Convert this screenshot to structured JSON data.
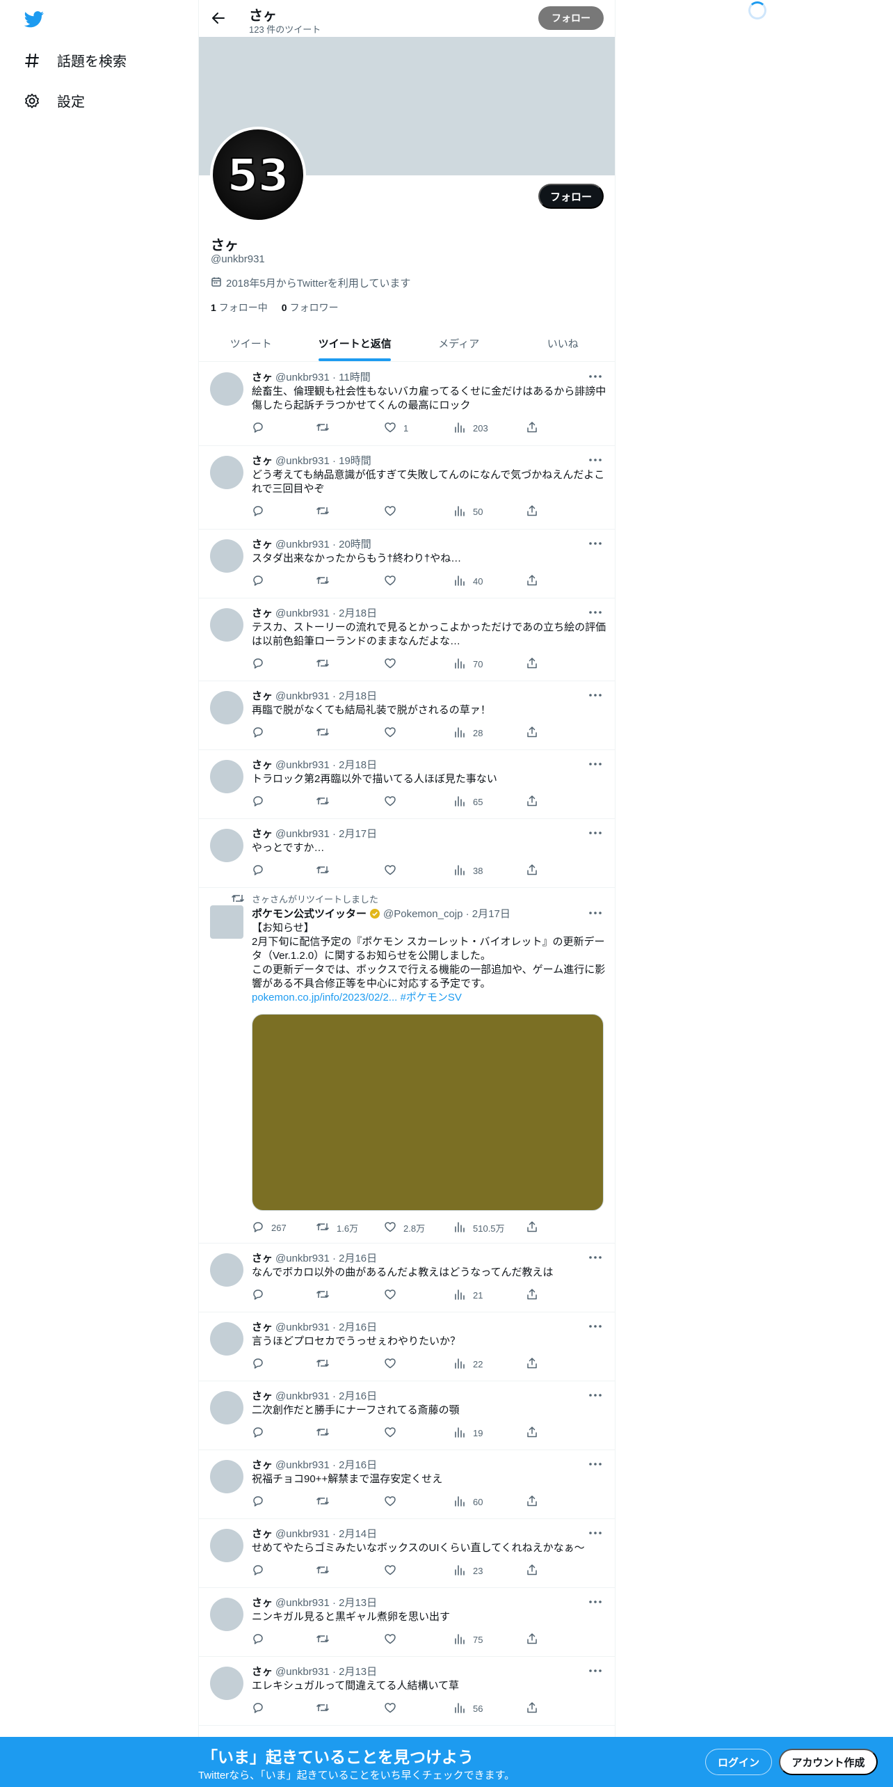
{
  "left_nav": {
    "items": [
      {
        "label": "話題を検索",
        "icon": "hashtag-icon"
      },
      {
        "label": "設定",
        "icon": "gear-icon"
      }
    ]
  },
  "header": {
    "name": "さヶ",
    "tweet_count": "123 件のツイート",
    "follow_label": "フォロー"
  },
  "profile": {
    "name": "さヶ",
    "handle": "@unkbr931",
    "joined": "2018年5月からTwitterを利用しています",
    "following_count": "1",
    "following_label": "フォロー中",
    "followers_count": "0",
    "followers_label": "フォロワー",
    "follow_label": "フォロー",
    "avatar_text": "53"
  },
  "tabs": [
    {
      "label": "ツイート"
    },
    {
      "label": "ツイートと返信"
    },
    {
      "label": "メディア"
    },
    {
      "label": "いいね"
    }
  ],
  "tweets": [
    {
      "name": "さヶ",
      "meta": "@unkbr931 · 11時間",
      "text": "絵畜生、倫理観も社会性もないバカ雇ってるくせに金だけはあるから誹謗中傷したら起訴チラつかせてくんの最高にロック",
      "reply": "",
      "retweet": "",
      "like": "1",
      "views": "203"
    },
    {
      "name": "さヶ",
      "meta": "@unkbr931 · 19時間",
      "text": "どう考えても納品意識が低すぎて失敗してんのになんで気づかねえんだよこれで三回目やぞ",
      "reply": "",
      "retweet": "",
      "like": "",
      "views": "50"
    },
    {
      "name": "さヶ",
      "meta": "@unkbr931 · 20時間",
      "text": "スタダ出来なかったからもう†終わり†やね…",
      "reply": "",
      "retweet": "",
      "like": "",
      "views": "40"
    },
    {
      "name": "さヶ",
      "meta": "@unkbr931 · 2月18日",
      "text": "テスカ、ストーリーの流れで見るとかっこよかっただけであの立ち絵の評価は以前色鉛筆ローランドのままなんだよな…",
      "reply": "",
      "retweet": "",
      "like": "",
      "views": "70"
    },
    {
      "name": "さヶ",
      "meta": "@unkbr931 · 2月18日",
      "text": "再臨で脱がなくても結局礼装で脱がされるの草ァ！",
      "reply": "",
      "retweet": "",
      "like": "",
      "views": "28"
    },
    {
      "name": "さヶ",
      "meta": "@unkbr931 · 2月18日",
      "text": "トラロック第2再臨以外で描いてる人ほぼ見た事ない",
      "reply": "",
      "retweet": "",
      "like": "",
      "views": "65"
    },
    {
      "name": "さヶ",
      "meta": "@unkbr931 · 2月17日",
      "text": "やっとですか…",
      "reply": "",
      "retweet": "",
      "like": "",
      "views": "38"
    }
  ],
  "retweet": {
    "note": "さヶさんがリツイートしました",
    "name": "ポケモン公式ツイッター",
    "meta": "@Pokemon_cojp · 2月17日",
    "text_lines": [
      "【お知らせ】",
      "2月下旬に配信予定の『ポケモン スカーレット・バイオレット』の更新データ（Ver.1.2.0）に関するお知らせを公開しました。",
      "この更新データでは、ボックスで行える機能の一部追加や、ゲーム進行に影響がある不具合修正等を中心に対応する予定です。"
    ],
    "link": "pokemon.co.jp/info/2023/02/2...",
    "hashtag": "#ポケモンSV",
    "media_color": "#7b6f24",
    "reply": "267",
    "retweet": "1.6万",
    "like": "2.8万",
    "views": "510.5万"
  },
  "tweets2": [
    {
      "name": "さヶ",
      "meta": "@unkbr931 · 2月16日",
      "text": "なんでボカロ以外の曲があるんだよ教えはどうなってんだ教えは",
      "reply": "",
      "retweet": "",
      "like": "",
      "views": "21"
    },
    {
      "name": "さヶ",
      "meta": "@unkbr931 · 2月16日",
      "text": "言うほどプロセカでうっせぇわやりたいか？",
      "reply": "",
      "retweet": "",
      "like": "",
      "views": "22"
    },
    {
      "name": "さヶ",
      "meta": "@unkbr931 · 2月16日",
      "text": "二次創作だと勝手にナーフされてる斎藤の顎",
      "reply": "",
      "retweet": "",
      "like": "",
      "views": "19"
    },
    {
      "name": "さヶ",
      "meta": "@unkbr931 · 2月16日",
      "text": "祝福チョコ90++解禁まで温存安定くせえ",
      "reply": "",
      "retweet": "",
      "like": "",
      "views": "60"
    },
    {
      "name": "さヶ",
      "meta": "@unkbr931 · 2月14日",
      "text": "せめてやたらゴミみたいなボックスのUIくらい直してくれねえかなぁ〜",
      "reply": "",
      "retweet": "",
      "like": "",
      "views": "23"
    },
    {
      "name": "さヶ",
      "meta": "@unkbr931 · 2月13日",
      "text": "ニンキガル見ると黒ギャル煮卵を思い出す",
      "reply": "",
      "retweet": "",
      "like": "",
      "views": "75"
    },
    {
      "name": "さヶ",
      "meta": "@unkbr931 · 2月13日",
      "text": "エレキシュガルって間違えてる人結構いて草",
      "reply": "",
      "retweet": "",
      "like": "",
      "views": "56"
    }
  ],
  "bottom_bar": {
    "title": "「いま」起きていることを見つけよう",
    "subtitle": "Twitterなら、「いま」起きていることをいち早くチェックできます。",
    "login": "ログイン",
    "signup": "アカウント作成"
  },
  "colors": {
    "accent": "#1d9bf0",
    "banner": "#cfd9de"
  }
}
